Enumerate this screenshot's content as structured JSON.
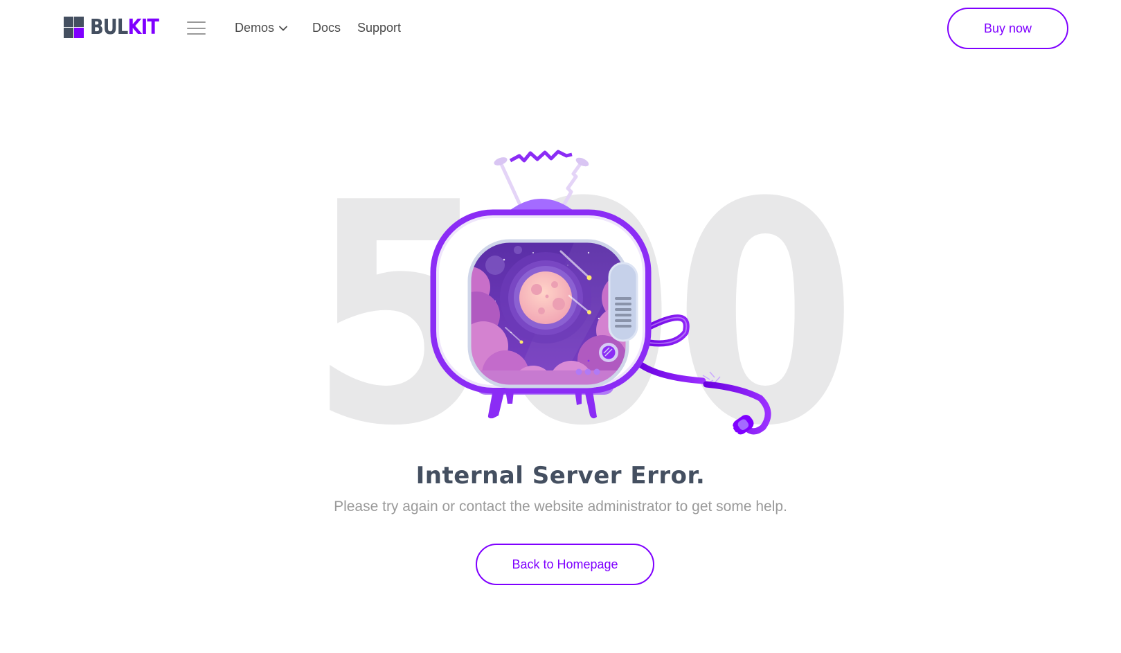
{
  "header": {
    "logo_text_a": "BUL",
    "logo_text_b": "KIT",
    "nav": [
      {
        "label": "Demos",
        "has_dropdown": true
      },
      {
        "label": "Docs"
      },
      {
        "label": "Support"
      }
    ],
    "buy_label": "Buy now"
  },
  "hero": {
    "code": "500",
    "title": "Internal Server Error.",
    "subtitle": "Please try again or contact the website administrator to get some help.",
    "button_label": "Back to Homepage"
  },
  "icons": {
    "menu": "hamburger-icon",
    "dropdown": "chevron-down-icon",
    "illustration": "broken-tv-illustration"
  },
  "colors": {
    "accent": "#7f00ff",
    "logo_dark": "#444f60",
    "watermark": "#e8e8e9",
    "title": "#444f60",
    "subtitle": "#9a9a9a"
  }
}
